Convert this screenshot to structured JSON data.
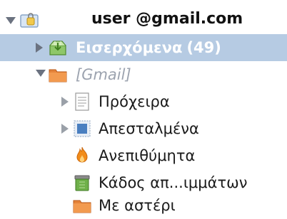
{
  "account": {
    "label": "user @gmail.com"
  },
  "folders": {
    "inbox": {
      "label": "Εισερχόμενα",
      "count": "(49)"
    },
    "gmail_group": {
      "label": "[Gmail]"
    },
    "drafts": {
      "label": "Πρόχειρα"
    },
    "sent": {
      "label": "Απεσταλμένα"
    },
    "spam": {
      "label": "Ανεπιθύμητα"
    },
    "trash": {
      "label": "Κάδος απ...ιμμάτων"
    },
    "starred": {
      "label": "Με αστέρι"
    }
  },
  "colors": {
    "selection": "#b6cbe3"
  }
}
